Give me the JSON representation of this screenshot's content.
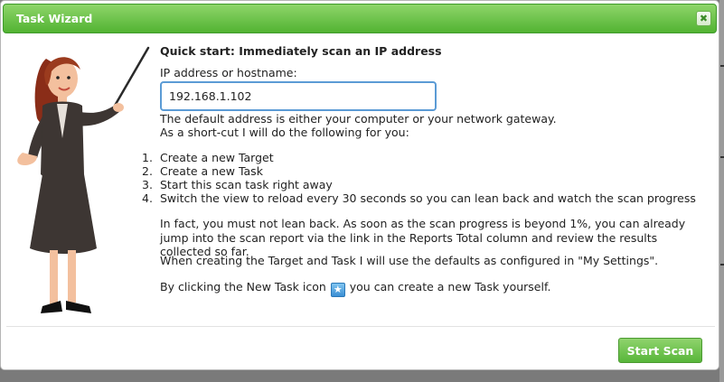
{
  "dialog": {
    "title": "Task Wizard",
    "close_glyph": "✖"
  },
  "content": {
    "heading": "Quick start: Immediately scan an IP address",
    "ip_label": "IP address or hostname:",
    "ip_value": "192.168.1.102",
    "hint_1": "The default address is either your computer or your network gateway.",
    "hint_2": "As a short-cut I will do the following for you:",
    "steps": [
      {
        "num": "1.",
        "text": "Create a new Target"
      },
      {
        "num": "2.",
        "text": "Create a new Task"
      },
      {
        "num": "3.",
        "text": "Start this scan task right away"
      },
      {
        "num": "4.",
        "text": "Switch the view to reload every 30 seconds so you can lean back and watch the scan progress"
      }
    ],
    "para_1": "In fact, you must not lean back. As soon as the scan progress is beyond 1%, you can already jump into the scan report via the link in the Reports Total column and review the results collected so far.",
    "para_2": "When creating the Target and Task I will use the defaults as configured in \"My Settings\".",
    "para_3_before": "By clicking the New Task icon",
    "para_3_after": "you can create a new Task yourself.",
    "new_task_icon": "new-task-icon"
  },
  "footer": {
    "start_label": "Start Scan"
  },
  "colors": {
    "titlebar_green": "#52b332",
    "input_border": "#5b9bd5",
    "button_green": "#58b63a"
  }
}
